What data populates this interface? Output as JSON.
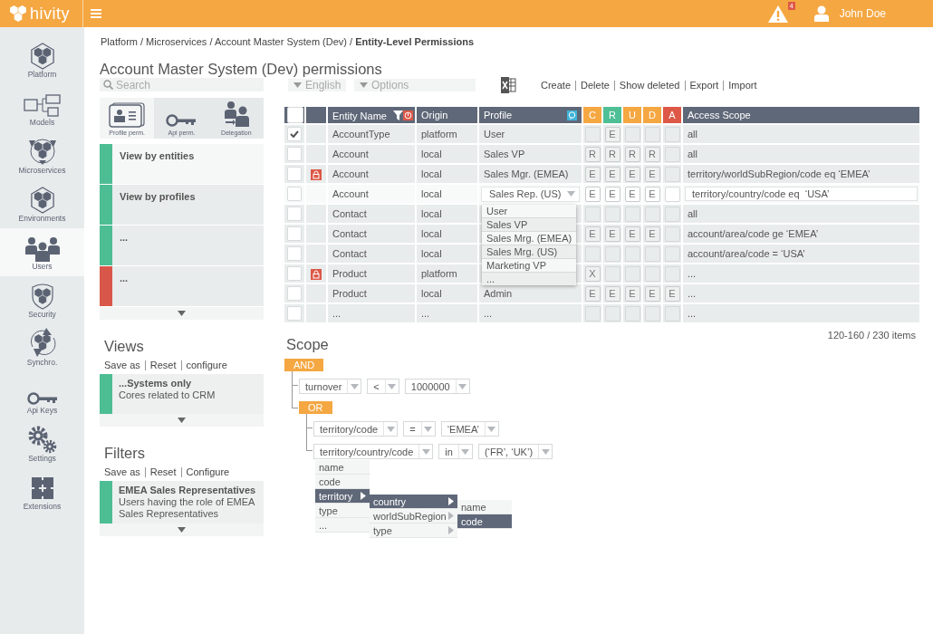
{
  "topbar": {
    "brand": "hivity",
    "alert_count": "4",
    "user": "John Doe"
  },
  "nav": [
    {
      "label": "Platform",
      "selected": false
    },
    {
      "label": "Models",
      "selected": false
    },
    {
      "label": "Microservices",
      "selected": false
    },
    {
      "label": "Environments",
      "selected": false
    },
    {
      "label": "Users",
      "selected": true
    },
    {
      "label": "Security",
      "selected": false
    },
    {
      "label": "Synchro.",
      "selected": false
    },
    {
      "label": "Api Keys",
      "selected": false
    },
    {
      "label": "Settings",
      "selected": false
    },
    {
      "label": "Extensions",
      "selected": false
    }
  ],
  "breadcrumb": "Platform / Microservices / Account Master System (Dev) / **Entity-Level Permissions**",
  "title": "Account Master System (Dev) permissions",
  "left_panel": {
    "search": {
      "placeholder": "Search"
    },
    "tabs": [
      {
        "label": "Profile perm.",
        "selected": true
      },
      {
        "label": "Api perm.",
        "selected": false
      },
      {
        "label": "Delegation",
        "selected": false
      }
    ],
    "entries": [
      {
        "title": "View by entities",
        "color": "#4dbd94",
        "selected": true
      },
      {
        "title": "View by profiles",
        "color": "#4dbd94",
        "selected": false
      },
      {
        "title": "...",
        "color": "#4dbd94",
        "selected": false
      },
      {
        "title": "...",
        "color": "#d9574a",
        "selected": false
      }
    ]
  },
  "sections": [
    {
      "title": "Views",
      "links": [
        "Save as",
        "Reset",
        "configure"
      ],
      "items": [
        {
          "title": "...Systems only",
          "description": "Cores related to CRM",
          "color": "#4dbd94"
        }
      ]
    },
    {
      "title": "Filters",
      "links": [
        "Save as",
        "Reset",
        "Configure"
      ],
      "items": [
        {
          "title": "EMEA Sales Representatives",
          "description": "Users having the role of EMEA Sales Representatives",
          "color": "#4dbd94"
        }
      ]
    }
  ],
  "toolbar": {
    "language": "English",
    "options": "Options",
    "actions": [
      "Create",
      "Delete",
      "Show deleted",
      "Export",
      "Import"
    ]
  },
  "table": {
    "all_selected": false,
    "columns": [
      "Entity Name",
      "Origin",
      "Profile"
    ],
    "perm_columns": [
      {
        "label": "C",
        "color": "#f5a742"
      },
      {
        "label": "R",
        "color": "#4fbf96"
      },
      {
        "label": "U",
        "color": "#f5a742"
      },
      {
        "label": "D",
        "color": "#f5a742"
      },
      {
        "label": "A",
        "color": "#dd5847"
      }
    ],
    "scope_column": "Access Scope",
    "rows": [
      {
        "selected": true,
        "locked": false,
        "editing": false,
        "entity": "AccountType",
        "origin": "platform",
        "profile": "User",
        "perms": [
          {
            "set": false
          },
          {
            "set": true,
            "value": "E"
          },
          {
            "set": false
          },
          {
            "set": false
          },
          {
            "set": false
          }
        ],
        "scope": "all"
      },
      {
        "selected": false,
        "locked": false,
        "editing": false,
        "entity": "Account",
        "origin": "local",
        "profile": "Sales VP",
        "perms": [
          {
            "set": true,
            "value": "R"
          },
          {
            "set": true,
            "value": "R"
          },
          {
            "set": true,
            "value": "R"
          },
          {
            "set": true,
            "value": "R"
          },
          {
            "set": false
          }
        ],
        "scope": "all"
      },
      {
        "selected": false,
        "locked": true,
        "editing": false,
        "entity": "Account",
        "origin": "local",
        "profile": "Sales Mgr. (EMEA)",
        "perms": [
          {
            "set": true,
            "value": "E"
          },
          {
            "set": true,
            "value": "E"
          },
          {
            "set": true,
            "value": "E"
          },
          {
            "set": true,
            "value": "E"
          },
          {
            "set": false
          }
        ],
        "scope": "territory/worldSubRegion/code eq ‘EMEA’"
      },
      {
        "selected": false,
        "locked": false,
        "editing": true,
        "entity": "Account",
        "origin": "local",
        "profile": "Sales Rep. (US)",
        "perms": [
          {
            "set": true,
            "value": "E"
          },
          {
            "set": true,
            "value": "E"
          },
          {
            "set": true,
            "value": "E"
          },
          {
            "set": true,
            "value": "E"
          },
          {
            "set": false
          }
        ],
        "scope": "territory/country/code eq  ‘USA’",
        "profile_options": [
          "User",
          "Sales VP",
          "Sales Mrg. (EMEA)",
          "Sales Mrg. (US)",
          "Marketing VP",
          "..."
        ]
      },
      {
        "selected": false,
        "locked": false,
        "editing": false,
        "entity": "Contact",
        "origin": "local",
        "perms": [
          {
            "set": false
          },
          {
            "set": false
          },
          {
            "set": false
          },
          {
            "set": false
          },
          {
            "set": false
          }
        ],
        "scope": "all"
      },
      {
        "selected": false,
        "locked": false,
        "editing": false,
        "entity": "Contact",
        "origin": "local",
        "perms": [
          {
            "set": true,
            "value": "E"
          },
          {
            "set": true,
            "value": "E"
          },
          {
            "set": true,
            "value": "E"
          },
          {
            "set": true,
            "value": "E"
          },
          {
            "set": false
          }
        ],
        "scope": "account/area/code ge ‘EMEA’"
      },
      {
        "selected": false,
        "locked": false,
        "editing": false,
        "entity": "Contact",
        "origin": "local",
        "perms": [
          {
            "set": false
          },
          {
            "set": false
          },
          {
            "set": false
          },
          {
            "set": false
          },
          {
            "set": false
          }
        ],
        "scope": "account/area/code = ‘USA’"
      },
      {
        "selected": false,
        "locked": true,
        "editing": false,
        "entity": "Product",
        "origin": "platform",
        "perms": [
          {
            "set": true,
            "value": "X"
          },
          {
            "set": false
          },
          {
            "set": false
          },
          {
            "set": false
          },
          {
            "set": false
          }
        ],
        "scope": "..."
      },
      {
        "selected": false,
        "locked": false,
        "editing": false,
        "entity": "Product",
        "origin": "local",
        "profile": "Admin",
        "perms": [
          {
            "set": true,
            "value": "E"
          },
          {
            "set": true,
            "value": "E"
          },
          {
            "set": true,
            "value": "E"
          },
          {
            "set": true,
            "value": "E"
          },
          {
            "set": true,
            "value": "E"
          }
        ],
        "scope": "..."
      },
      {
        "selected": false,
        "locked": false,
        "editing": false,
        "entity": "...",
        "origin": "...",
        "profile": "...",
        "perms": [
          {
            "set": false
          },
          {
            "set": false
          },
          {
            "set": false
          },
          {
            "set": false
          },
          {
            "set": false
          }
        ],
        "scope": "..."
      }
    ],
    "pager": "120-160 / 230 items"
  },
  "scope": {
    "title": "Scope",
    "root": {
      "kind": "group",
      "operator": "AND",
      "children": [
        {
          "kind": "condition",
          "field": "turnover",
          "operator": "<",
          "value": "1000000"
        },
        {
          "kind": "group",
          "operator": "OR",
          "children": [
            {
              "kind": "condition",
              "field": "territory/code",
              "operator": "=",
              "value": "‘EMEA’"
            },
            {
              "kind": "condition",
              "field": "territory/country/code",
              "operator": "in",
              "value": "(‘FR’, ‘UK’)",
              "field_menu": {
                "items": [
                  {
                    "label": "name",
                    "selected": false,
                    "expandable": false
                  },
                  {
                    "label": "code",
                    "selected": false,
                    "expandable": false
                  },
                  {
                    "label": "territory",
                    "selected": true,
                    "expandable": true,
                    "children": [
                      {
                        "label": "country",
                        "selected": true,
                        "expandable": true,
                        "children": [
                          {
                            "label": "name",
                            "selected": false,
                            "expandable": false
                          },
                          {
                            "label": "code",
                            "selected": true,
                            "expandable": false
                          }
                        ]
                      },
                      {
                        "label": "worldSubRegion",
                        "selected": false,
                        "expandable": true
                      },
                      {
                        "label": "type",
                        "selected": false,
                        "expandable": true
                      }
                    ]
                  },
                  {
                    "label": "type",
                    "selected": false,
                    "expandable": false
                  },
                  {
                    "label": "...",
                    "selected": false,
                    "expandable": false
                  }
                ]
              }
            }
          ]
        }
      ]
    }
  }
}
